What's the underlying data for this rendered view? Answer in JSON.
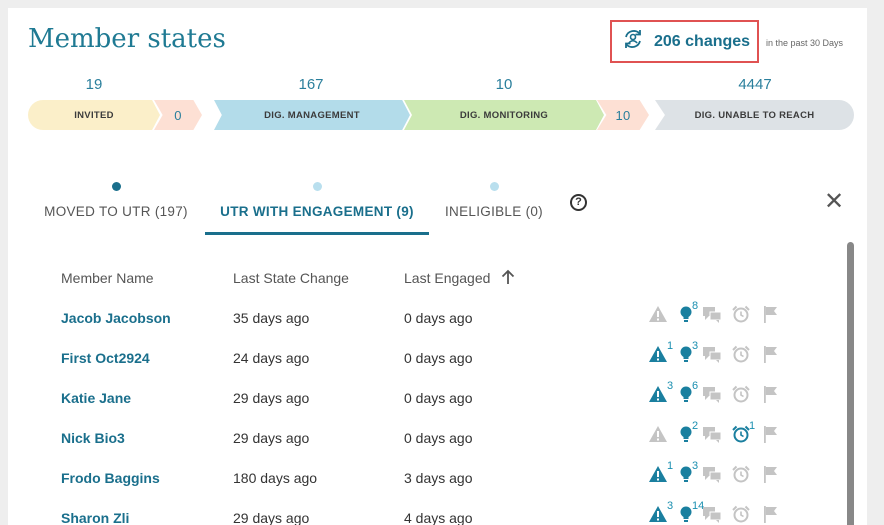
{
  "header": {
    "title": "Member states",
    "changes_count": "206 changes",
    "changes_period": "in the past 30 Days"
  },
  "pipeline": {
    "counts": {
      "invited": "19",
      "management": "167",
      "monitoring": "10",
      "unable": "4447"
    },
    "segments": {
      "invited": "INVITED",
      "invited_to_mgmt": "0",
      "management": "DIG. MANAGEMENT",
      "monitoring": "DIG. MONITORING",
      "monitoring_to_unable": "10",
      "unable": "DIG. UNABLE TO REACH"
    }
  },
  "tabs": [
    {
      "label": "MOVED TO UTR (197)",
      "dot_color": "#1a6f8c",
      "active": false
    },
    {
      "label": "UTR WITH ENGAGEMENT (9)",
      "dot_color": "#b9dfee",
      "active": true
    },
    {
      "label": "INELIGIBLE (0)",
      "dot_color": "#b9dfee",
      "active": false
    }
  ],
  "help_label": "?",
  "table": {
    "headers": [
      "Member Name",
      "Last State Change",
      "Last Engaged"
    ],
    "rows": [
      {
        "name": "Jacob Jacobson",
        "state_change": "35 days ago",
        "engaged": "0 days ago",
        "alert": "",
        "tips": "8",
        "alarm": ""
      },
      {
        "name": "First Oct2924",
        "state_change": "24 days ago",
        "engaged": "0 days ago",
        "alert": "1",
        "tips": "3",
        "alarm": ""
      },
      {
        "name": "Katie Jane",
        "state_change": "29 days ago",
        "engaged": "0 days ago",
        "alert": "3",
        "tips": "6",
        "alarm": ""
      },
      {
        "name": "Nick Bio3",
        "state_change": "29 days ago",
        "engaged": "0 days ago",
        "alert": "",
        "tips": "2",
        "alarm": "1"
      },
      {
        "name": "Frodo Baggins",
        "state_change": "180 days ago",
        "engaged": "3 days ago",
        "alert": "1",
        "tips": "3",
        "alarm": ""
      },
      {
        "name": "Sharon Zli",
        "state_change": "29 days ago",
        "engaged": "4 days ago",
        "alert": "3",
        "tips": "14",
        "alarm": ""
      }
    ]
  },
  "colors": {
    "accent": "#1a6f8c",
    "invited": "#fbefc9",
    "transition": "#fde0d4",
    "management": "#b3dcea",
    "monitoring": "#cde9b3",
    "unable": "#dde2e6",
    "icon_gray": "#c4c4c4",
    "icon_active": "#1a7f9f"
  }
}
